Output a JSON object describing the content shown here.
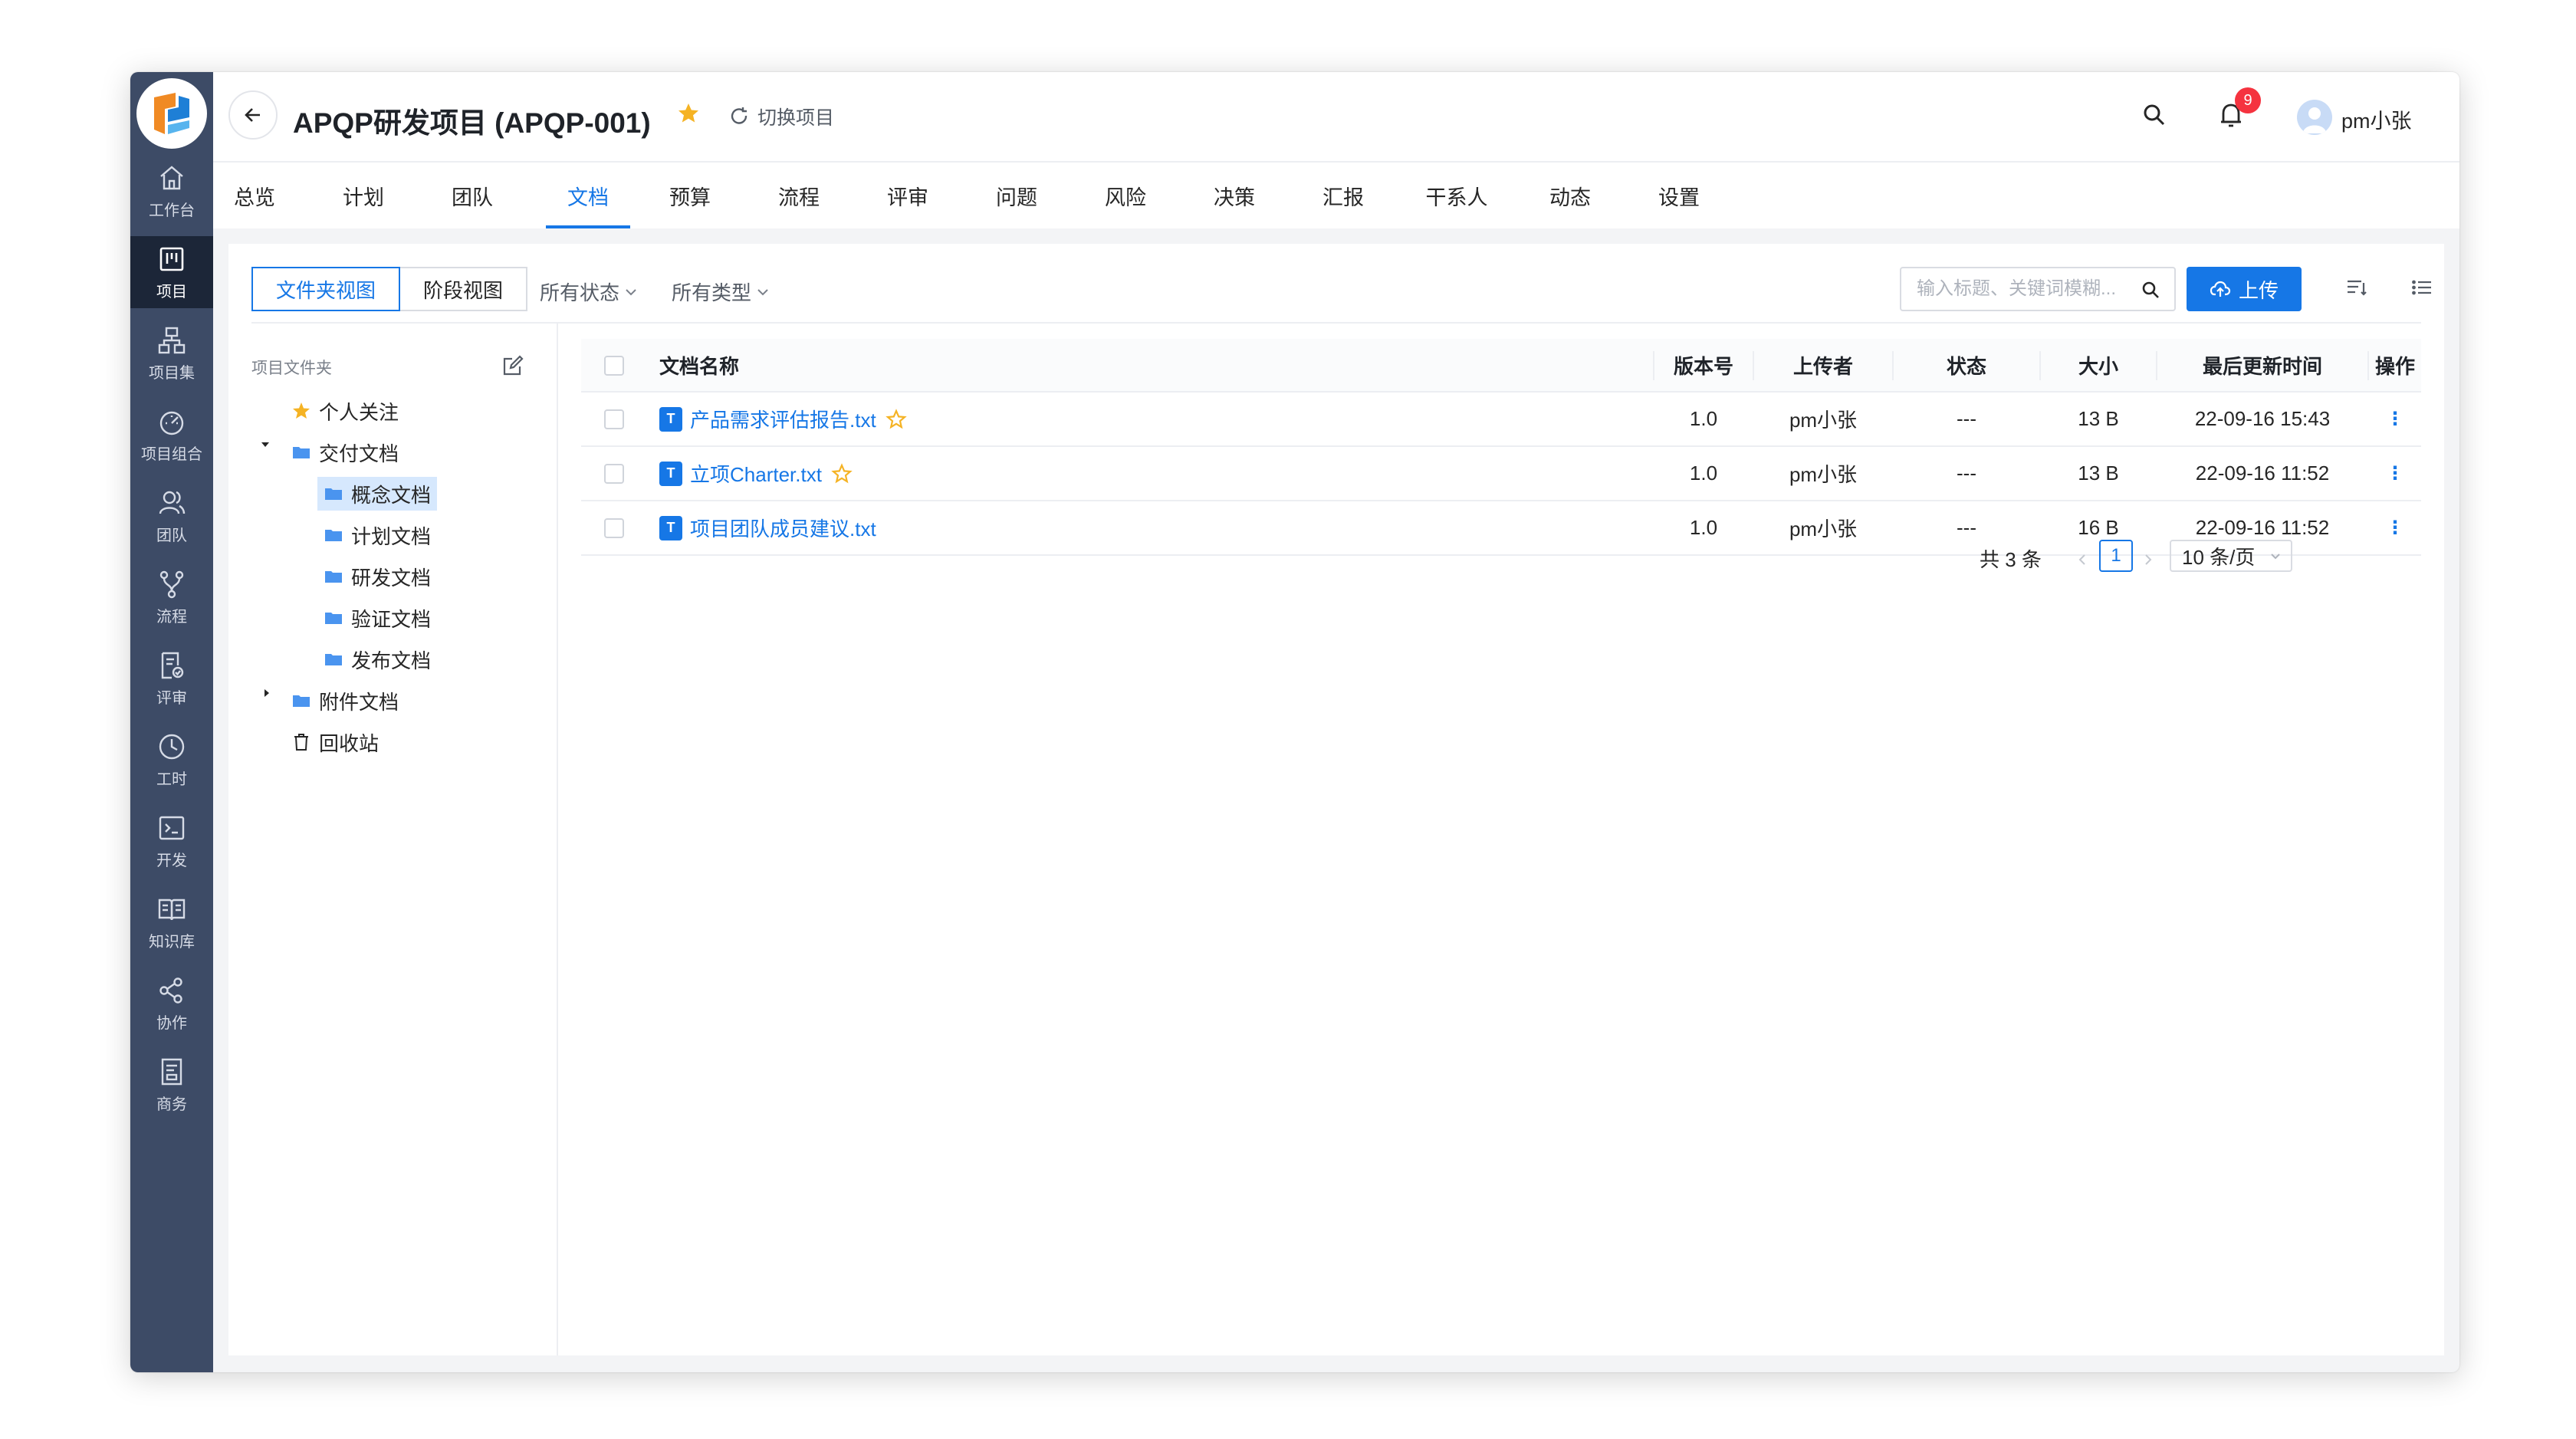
{
  "project": {
    "title": "APQP研发项目 (APQP-001)",
    "switch_label": "切换项目"
  },
  "header": {
    "notifications": "9",
    "user": "pm小张"
  },
  "sidebar": {
    "items": [
      {
        "label": "工作台",
        "icon": "home-icon"
      },
      {
        "label": "项目",
        "icon": "kanban-icon"
      },
      {
        "label": "项目集",
        "icon": "hierarchy-icon"
      },
      {
        "label": "项目组合",
        "icon": "dashboard-gauge-icon"
      },
      {
        "label": "团队",
        "icon": "team-icon"
      },
      {
        "label": "流程",
        "icon": "branch-icon"
      },
      {
        "label": "评审",
        "icon": "review-doc-icon"
      },
      {
        "label": "工时",
        "icon": "clock-icon"
      },
      {
        "label": "开发",
        "icon": "terminal-icon"
      },
      {
        "label": "知识库",
        "icon": "book-icon"
      },
      {
        "label": "协作",
        "icon": "share-icon"
      },
      {
        "label": "商务",
        "icon": "invoice-icon"
      }
    ],
    "active_index": 1
  },
  "tabs": [
    "总览",
    "计划",
    "团队",
    "文档",
    "预算",
    "流程",
    "评审",
    "问题",
    "风险",
    "决策",
    "汇报",
    "干系人",
    "动态",
    "设置"
  ],
  "active_tab": "文档",
  "toolbar": {
    "view_folder": "文件夹视图",
    "view_stage": "阶段视图",
    "filter_status": "所有状态",
    "filter_type": "所有类型",
    "search_placeholder": "输入标题、关键词模糊...",
    "upload": "上传"
  },
  "tree": {
    "header": "项目文件夹",
    "favorites": "个人关注",
    "deliverables": "交付文档",
    "children": [
      "概念文档",
      "计划文档",
      "研发文档",
      "验证文档",
      "发布文档"
    ],
    "selected_child": "概念文档",
    "attachments": "附件文档",
    "recycle": "回收站"
  },
  "table": {
    "headers": {
      "name": "文档名称",
      "version": "版本号",
      "uploader": "上传者",
      "status": "状态",
      "size": "大小",
      "updated": "最后更新时间",
      "ops": "操作"
    },
    "rows": [
      {
        "icon_letter": "T",
        "name": "产品需求评估报告.txt",
        "version": "1.0",
        "uploader": "pm小张",
        "status": "---",
        "size": "13 B",
        "updated": "22-09-16 15:43",
        "ops": "⋮"
      },
      {
        "icon_letter": "T",
        "name": "立项Charter.txt",
        "version": "1.0",
        "uploader": "pm小张",
        "status": "---",
        "size": "13 B",
        "updated": "22-09-16 11:52",
        "ops": "⋮"
      },
      {
        "icon_letter": "T",
        "name": "项目团队成员建议.txt",
        "version": "1.0",
        "uploader": "pm小张",
        "status": "---",
        "size": "16 B",
        "updated": "22-09-16 11:52",
        "ops": "⋮"
      }
    ]
  },
  "pagination": {
    "total": "共 3 条",
    "current": "1",
    "page_size": "10 条/页"
  },
  "colors": {
    "accent": "#1677e6",
    "sidebar": "#3d4b66",
    "sidebar_active": "#1c2638",
    "star": "#f5b324",
    "badge": "#f5333f"
  }
}
